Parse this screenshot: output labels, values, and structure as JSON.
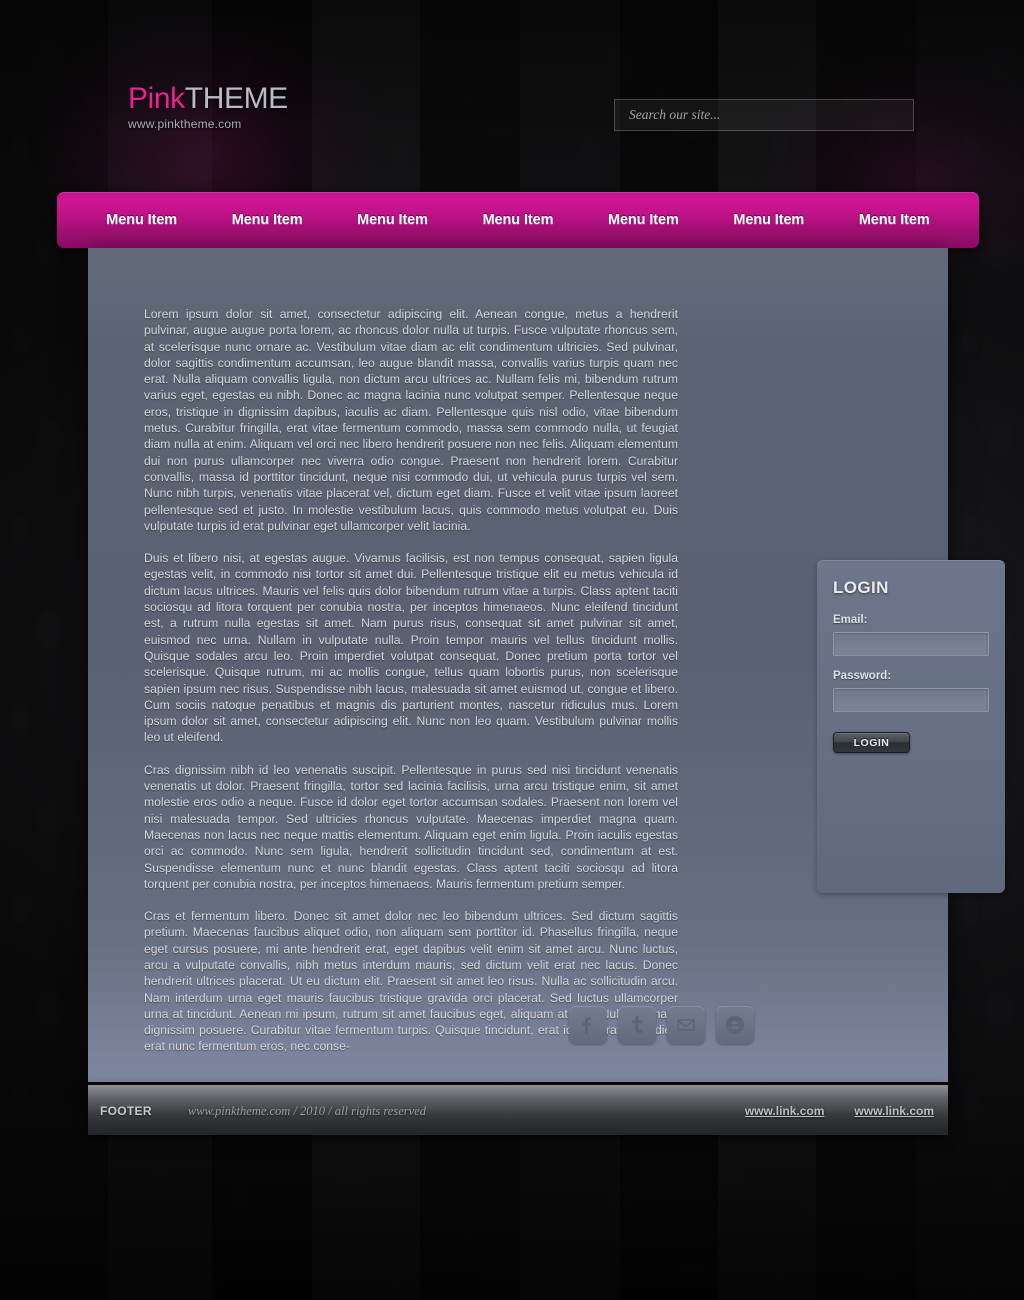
{
  "header": {
    "logo": {
      "pink_part": "Pink",
      "rest_part": "THEME",
      "subtitle": "www.pinktheme.com"
    },
    "search": {
      "placeholder": "Search our site...",
      "value": ""
    }
  },
  "nav": {
    "items": [
      {
        "label": "Menu Item"
      },
      {
        "label": "Menu Item"
      },
      {
        "label": "Menu Item"
      },
      {
        "label": "Menu Item"
      },
      {
        "label": "Menu Item"
      },
      {
        "label": "Menu Item"
      },
      {
        "label": "Menu Item"
      }
    ]
  },
  "main": {
    "paragraphs": [
      "Lorem ipsum dolor sit amet, consectetur adipiscing elit. Aenean congue, metus a hendrerit pulvinar, augue augue porta lorem, ac rhoncus dolor nulla ut turpis. Fusce vulputate rhoncus sem, at scelerisque nunc ornare ac. Vestibulum vitae diam ac elit condimentum ultricies. Sed pulvinar, dolor sagittis condimentum accumsan, leo augue blandit massa, convallis varius turpis quam nec erat. Nulla aliquam convallis ligula, non dictum arcu ultrices ac. Nullam felis mi, bibendum rutrum varius eget, egestas eu nibh. Donec ac magna lacinia nunc volutpat semper. Pellentesque neque eros, tristique in dignissim dapibus, iaculis ac diam. Pellentesque quis nisl odio, vitae bibendum metus. Curabitur fringilla, erat vitae fermentum commodo, massa sem commodo nulla, ut feugiat diam nulla at enim. Aliquam vel orci nec libero hendrerit posuere non nec felis. Aliquam elementum dui non purus ullamcorper nec viverra odio congue. Praesent non hendrerit lorem. Curabitur convallis, massa id porttitor tincidunt, neque nisi commodo dui, ut vehicula purus turpis vel sem. Nunc nibh turpis, venenatis vitae placerat vel, dictum eget diam. Fusce et velit vitae ipsum laoreet pellentesque sed et justo. In molestie vestibulum lacus, quis commodo metus volutpat eu. Duis vulputate turpis id erat pulvinar eget ullamcorper velit lacinia.",
      "Duis et libero nisi, at egestas augue. Vivamus facilisis, est non tempus consequat, sapien ligula egestas velit, in commodo nisi tortor sit amet dui. Pellentesque tristique elit eu metus vehicula id dictum lacus ultrices. Mauris vel felis quis dolor bibendum rutrum vitae a turpis. Class aptent taciti sociosqu ad litora torquent per conubia nostra, per inceptos himenaeos. Nunc eleifend tincidunt est, a rutrum nulla egestas sit amet. Nam purus risus, consequat sit amet pulvinar sit amet, euismod nec urna. Nullam in vulputate nulla. Proin tempor mauris vel tellus tincidunt mollis. Quisque sodales arcu leo. Proin imperdiet volutpat consequat. Donec pretium porta tortor vel scelerisque. Quisque rutrum, mi ac mollis congue, tellus quam lobortis purus, non scelerisque sapien ipsum nec risus. Suspendisse nibh lacus, malesuada sit amet euismod ut, congue et libero. Cum sociis natoque penatibus et magnis dis parturient montes, nascetur ridiculus mus. Lorem ipsum dolor sit amet, consectetur adipiscing elit. Nunc non leo quam. Vestibulum pulvinar mollis leo ut eleifend.",
      "Cras dignissim nibh id leo venenatis suscipit. Pellentesque in purus sed nisi tincidunt venenatis venenatis ut dolor. Praesent fringilla, tortor sed lacinia facilisis, urna arcu tristique enim, sit amet molestie eros odio a neque. Fusce id dolor eget tortor accumsan sodales. Praesent non lorem vel nisi malesuada tempor. Sed ultricies rhoncus vulputate. Maecenas imperdiet magna quam. Maecenas non lacus nec neque mattis elementum. Aliquam eget enim ligula. Proin iaculis egestas orci ac commodo. Nunc sem ligula, hendrerit sollicitudin tincidunt sed, condimentum at est. Suspendisse elementum nunc et nunc blandit egestas. Class aptent taciti sociosqu ad litora torquent per conubia nostra, per inceptos himenaeos. Mauris fermentum pretium semper.",
      "Cras et fermentum libero. Donec sit amet dolor nec leo bibendum ultrices. Sed dictum sagittis pretium. Maecenas faucibus aliquet odio, non aliquam sem porttitor id. Phasellus fringilla, neque eget cursus posuere, mi ante hendrerit erat, eget dapibus velit enim sit amet arcu. Nunc luctus, arcu a vulputate convallis, nibh metus interdum mauris, sed dictum velit erat nec lacus. Donec hendrerit ultrices placerat. Ut eu dictum elit. Praesent sit amet leo risus. Nulla ac sollicitudin arcu. Nam interdum urna eget mauris faucibus tristique gravida orci placerat. Sed luctus ullamcorper urna at tincidunt. Aenean mi ipsum, rutrum sit amet faucibus eget, aliquam at erat. Nullam ornare dignissim posuere. Curabitur vitae fermentum turpis. Quisque tincidunt, erat id placerat imperdiet, erat nunc fermentum eros, nec conse-"
    ],
    "social": [
      {
        "name": "facebook",
        "glyph": "f"
      },
      {
        "name": "twitter",
        "glyph": "t"
      },
      {
        "name": "email",
        "glyph": "envelope"
      },
      {
        "name": "blogger",
        "glyph": "b"
      }
    ]
  },
  "login": {
    "heading": "LOGIN",
    "email_label": "Email:",
    "email_value": "",
    "email_placeholder": "",
    "password_label": "Password:",
    "password_value": "",
    "password_placeholder": "",
    "button_label": "LOGIN"
  },
  "footer": {
    "label": "FOOTER",
    "copyright": "www.pinktheme.com / 2010 / all rights reserved",
    "links": [
      {
        "label": "www.link.com"
      },
      {
        "label": "www.link.com"
      }
    ]
  },
  "colors": {
    "accent_pink": "#cf1494",
    "logo_pink": "#ef1e9a",
    "panel_blue_gray": "#5a6272",
    "background_dark": "#131214"
  }
}
